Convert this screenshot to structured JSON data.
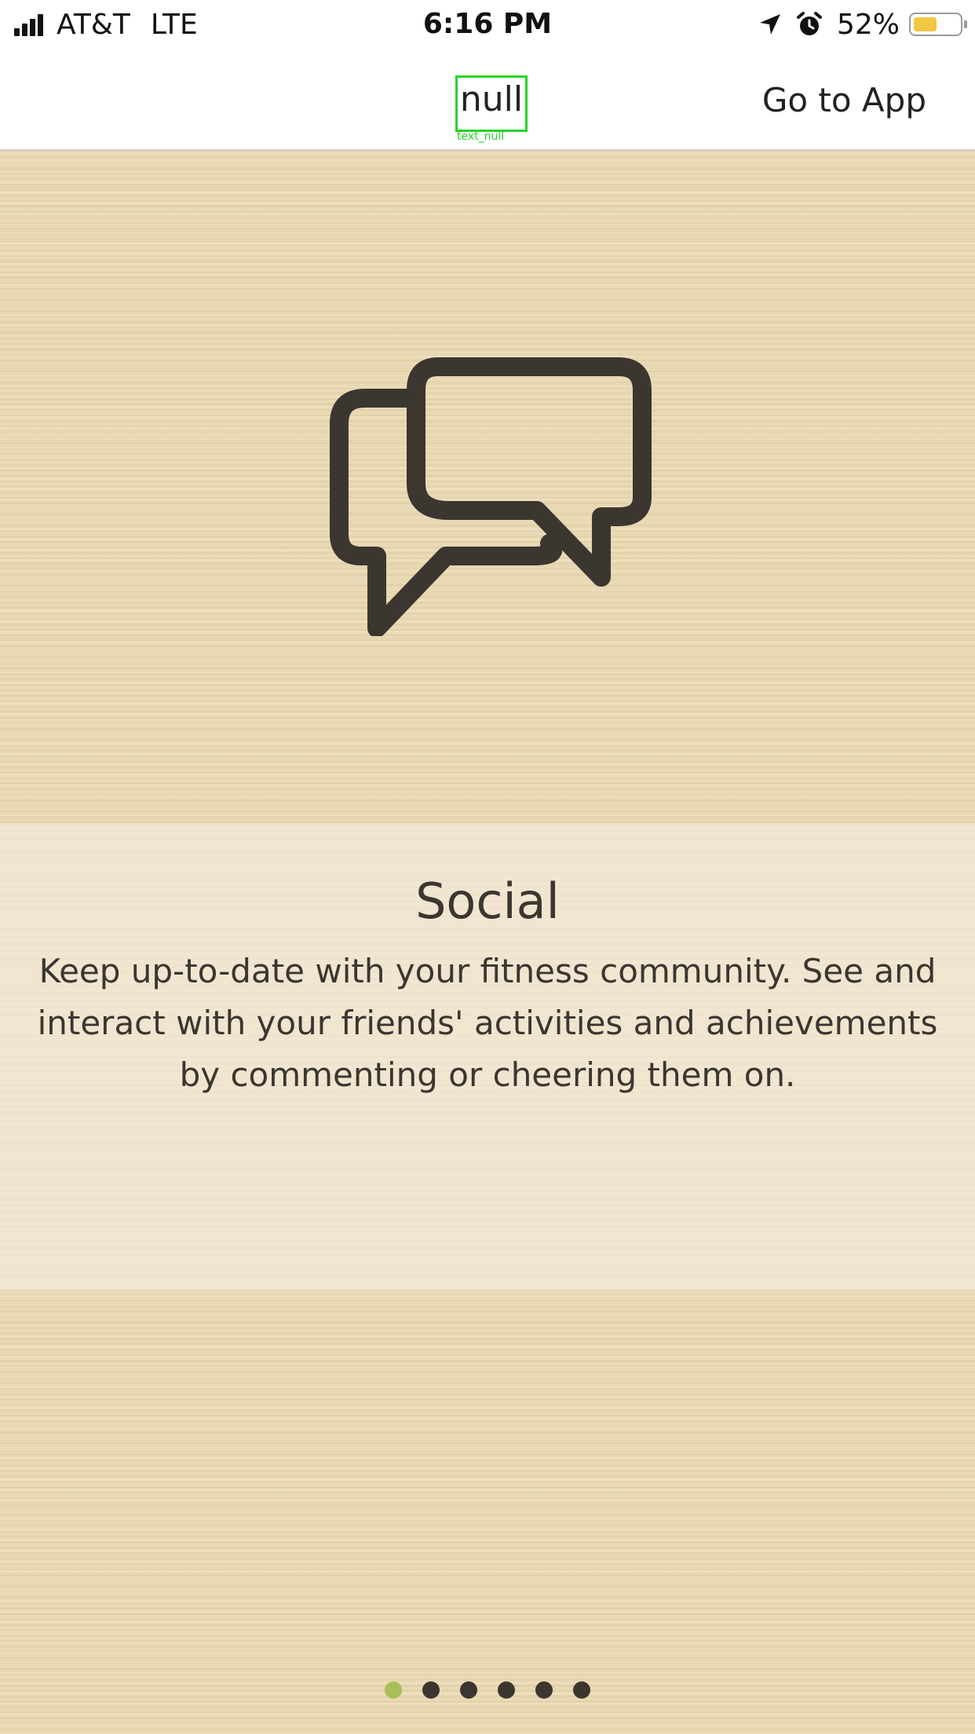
{
  "status_bar": {
    "carrier": "AT&T",
    "network": "LTE",
    "time": "6:16 PM",
    "battery_text": "52%",
    "battery_level": 0.52,
    "battery_color": "#f2c744",
    "icons": [
      "signal-icon",
      "location-arrow-icon",
      "alarm-icon",
      "battery-icon"
    ]
  },
  "nav": {
    "title": "null",
    "title_tag": "text_null",
    "go_to_app_label": "Go to App"
  },
  "feature": {
    "icon": "chat-bubbles-icon",
    "title": "Social",
    "description": "Keep up-to-date with your fitness community. See and interact with your friends' activities and achievements by commenting or cheering them on."
  },
  "pagination": {
    "count": 6,
    "active_index": 0,
    "active_color": "#a7bf58",
    "inactive_color": "#3b3630"
  }
}
